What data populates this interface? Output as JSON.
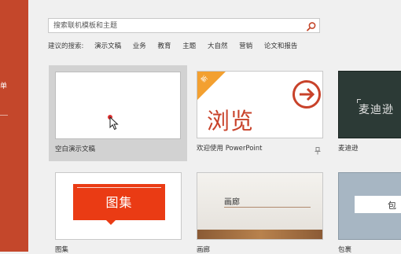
{
  "sidebar": {
    "menu_item_label": "单"
  },
  "search": {
    "placeholder": "搜索联机模板和主题"
  },
  "suggestions": {
    "label": "建议的搜索:",
    "items": [
      "演示文稿",
      "业务",
      "教育",
      "主题",
      "大自然",
      "营销",
      "论文和报告"
    ]
  },
  "templates": [
    {
      "caption": "空白演示文稿",
      "selected": true
    },
    {
      "caption": "欢迎使用 PowerPoint",
      "thumb_title": "浏览",
      "badge": "新"
    },
    {
      "caption": "麦迪逊",
      "thumb_title": "麦迪逊"
    },
    {
      "caption": "图集",
      "thumb_title": "图集"
    },
    {
      "caption": "画廊",
      "thumb_title": "画廊"
    },
    {
      "caption": "包裹",
      "thumb_title": "包"
    }
  ],
  "colors": {
    "accent": "#c4472b",
    "gallery_red": "#ea3b14",
    "madison_bg": "#2c3a36",
    "parcel_bg": "#a7b6c3"
  }
}
